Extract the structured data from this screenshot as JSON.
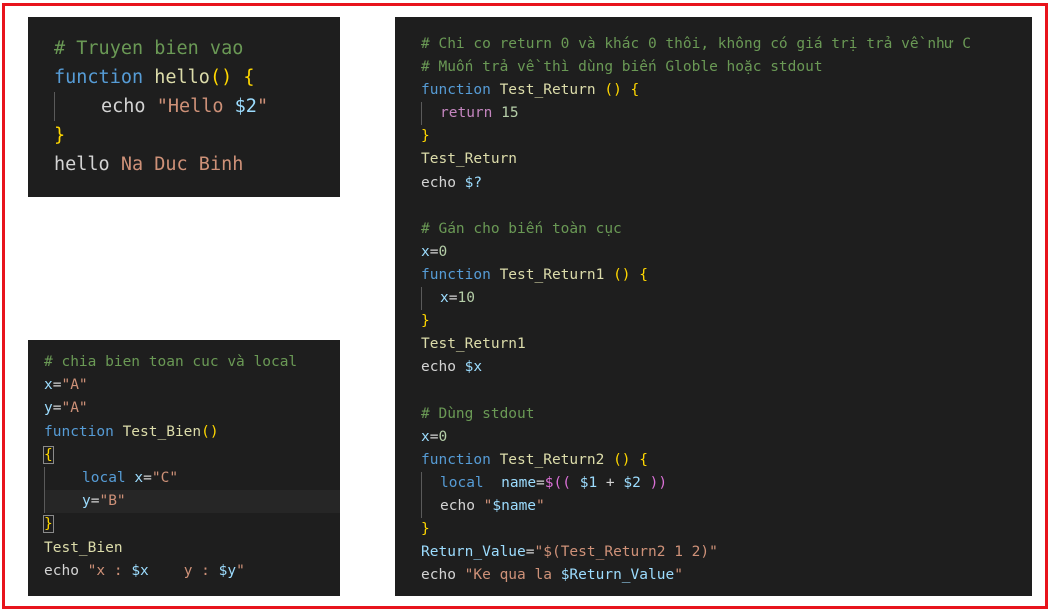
{
  "panel1": {
    "comment": "# Truyen bien vao",
    "kw_function": "function",
    "fn_name": "hello",
    "parens": "()",
    "brace_open": "{",
    "echo": "echo",
    "echo_str": "\"Hello ",
    "echo_var": "$2",
    "echo_str_end": "\"",
    "brace_close": "}",
    "call_name": "hello",
    "call_args": "Na Duc Binh"
  },
  "panel2": {
    "comment": "# chia bien toan cuc và local",
    "x_name": "x",
    "x_val": "\"A\"",
    "y_name": "y",
    "y_val": "\"A\"",
    "kw_function": "function",
    "fn_name": "Test_Bien",
    "parens": "()",
    "brace_open": "{",
    "local": "local",
    "lx_name": "x",
    "lx_val": "\"C\"",
    "ly_name": "y",
    "ly_val": "\"B\"",
    "brace_close": "}",
    "call": "Test_Bien",
    "echo": "echo",
    "echo_s1": "\"x : ",
    "echo_v1": "$x",
    "echo_s2": "    y : ",
    "echo_v2": "$y",
    "echo_s3": "\""
  },
  "panel3": {
    "c1": "# Chi co return 0 và khác 0 thôi, không có giá trị trả về như C",
    "c2": "# Muốn trả về thì dùng biến Globle hoặc stdout",
    "f1_kw": "function",
    "f1_name": "Test_Return",
    "f1_parens": " ()",
    "brace_open": "{",
    "return_kw": "return",
    "return_val": "15",
    "brace_close": "}",
    "call1": "Test_Return",
    "echo": "echo",
    "echo1_var": "$?",
    "c3": "# Gán cho biến toàn cục",
    "x_name": "x",
    "x0": "0",
    "f2_name": "Test_Return1",
    "x10": "10",
    "call2": "Test_Return1",
    "echo2_var": "$x",
    "c4": "# Dùng stdout",
    "f3_name": "Test_Return2",
    "local": "local",
    "name_var": "name",
    "arith_open": "$((",
    "arg1": "$1",
    "plus": " + ",
    "arg2": "$2",
    "arith_close": " ))",
    "echo3_s": "\"",
    "echo3_var": "$name",
    "echo3_e": "\"",
    "rv_name": "Return_Value",
    "rv_s1": "\"$(",
    "rv_fn": "Test_Return2",
    "rv_args": " 1 2",
    "rv_s2": ")\"",
    "echo4_s1": "\"Ke qua la ",
    "echo4_var": "$Return_Value",
    "echo4_s2": "\""
  },
  "colors": {
    "frame": "#e8141c",
    "editor_bg": "#1e1e1e",
    "comment": "#6a9955",
    "keyword": "#569cd6",
    "function": "#dcdcaa",
    "variable": "#9cdcfe",
    "string": "#ce9178",
    "number": "#b5cea8",
    "bracket": "#ffd700"
  }
}
